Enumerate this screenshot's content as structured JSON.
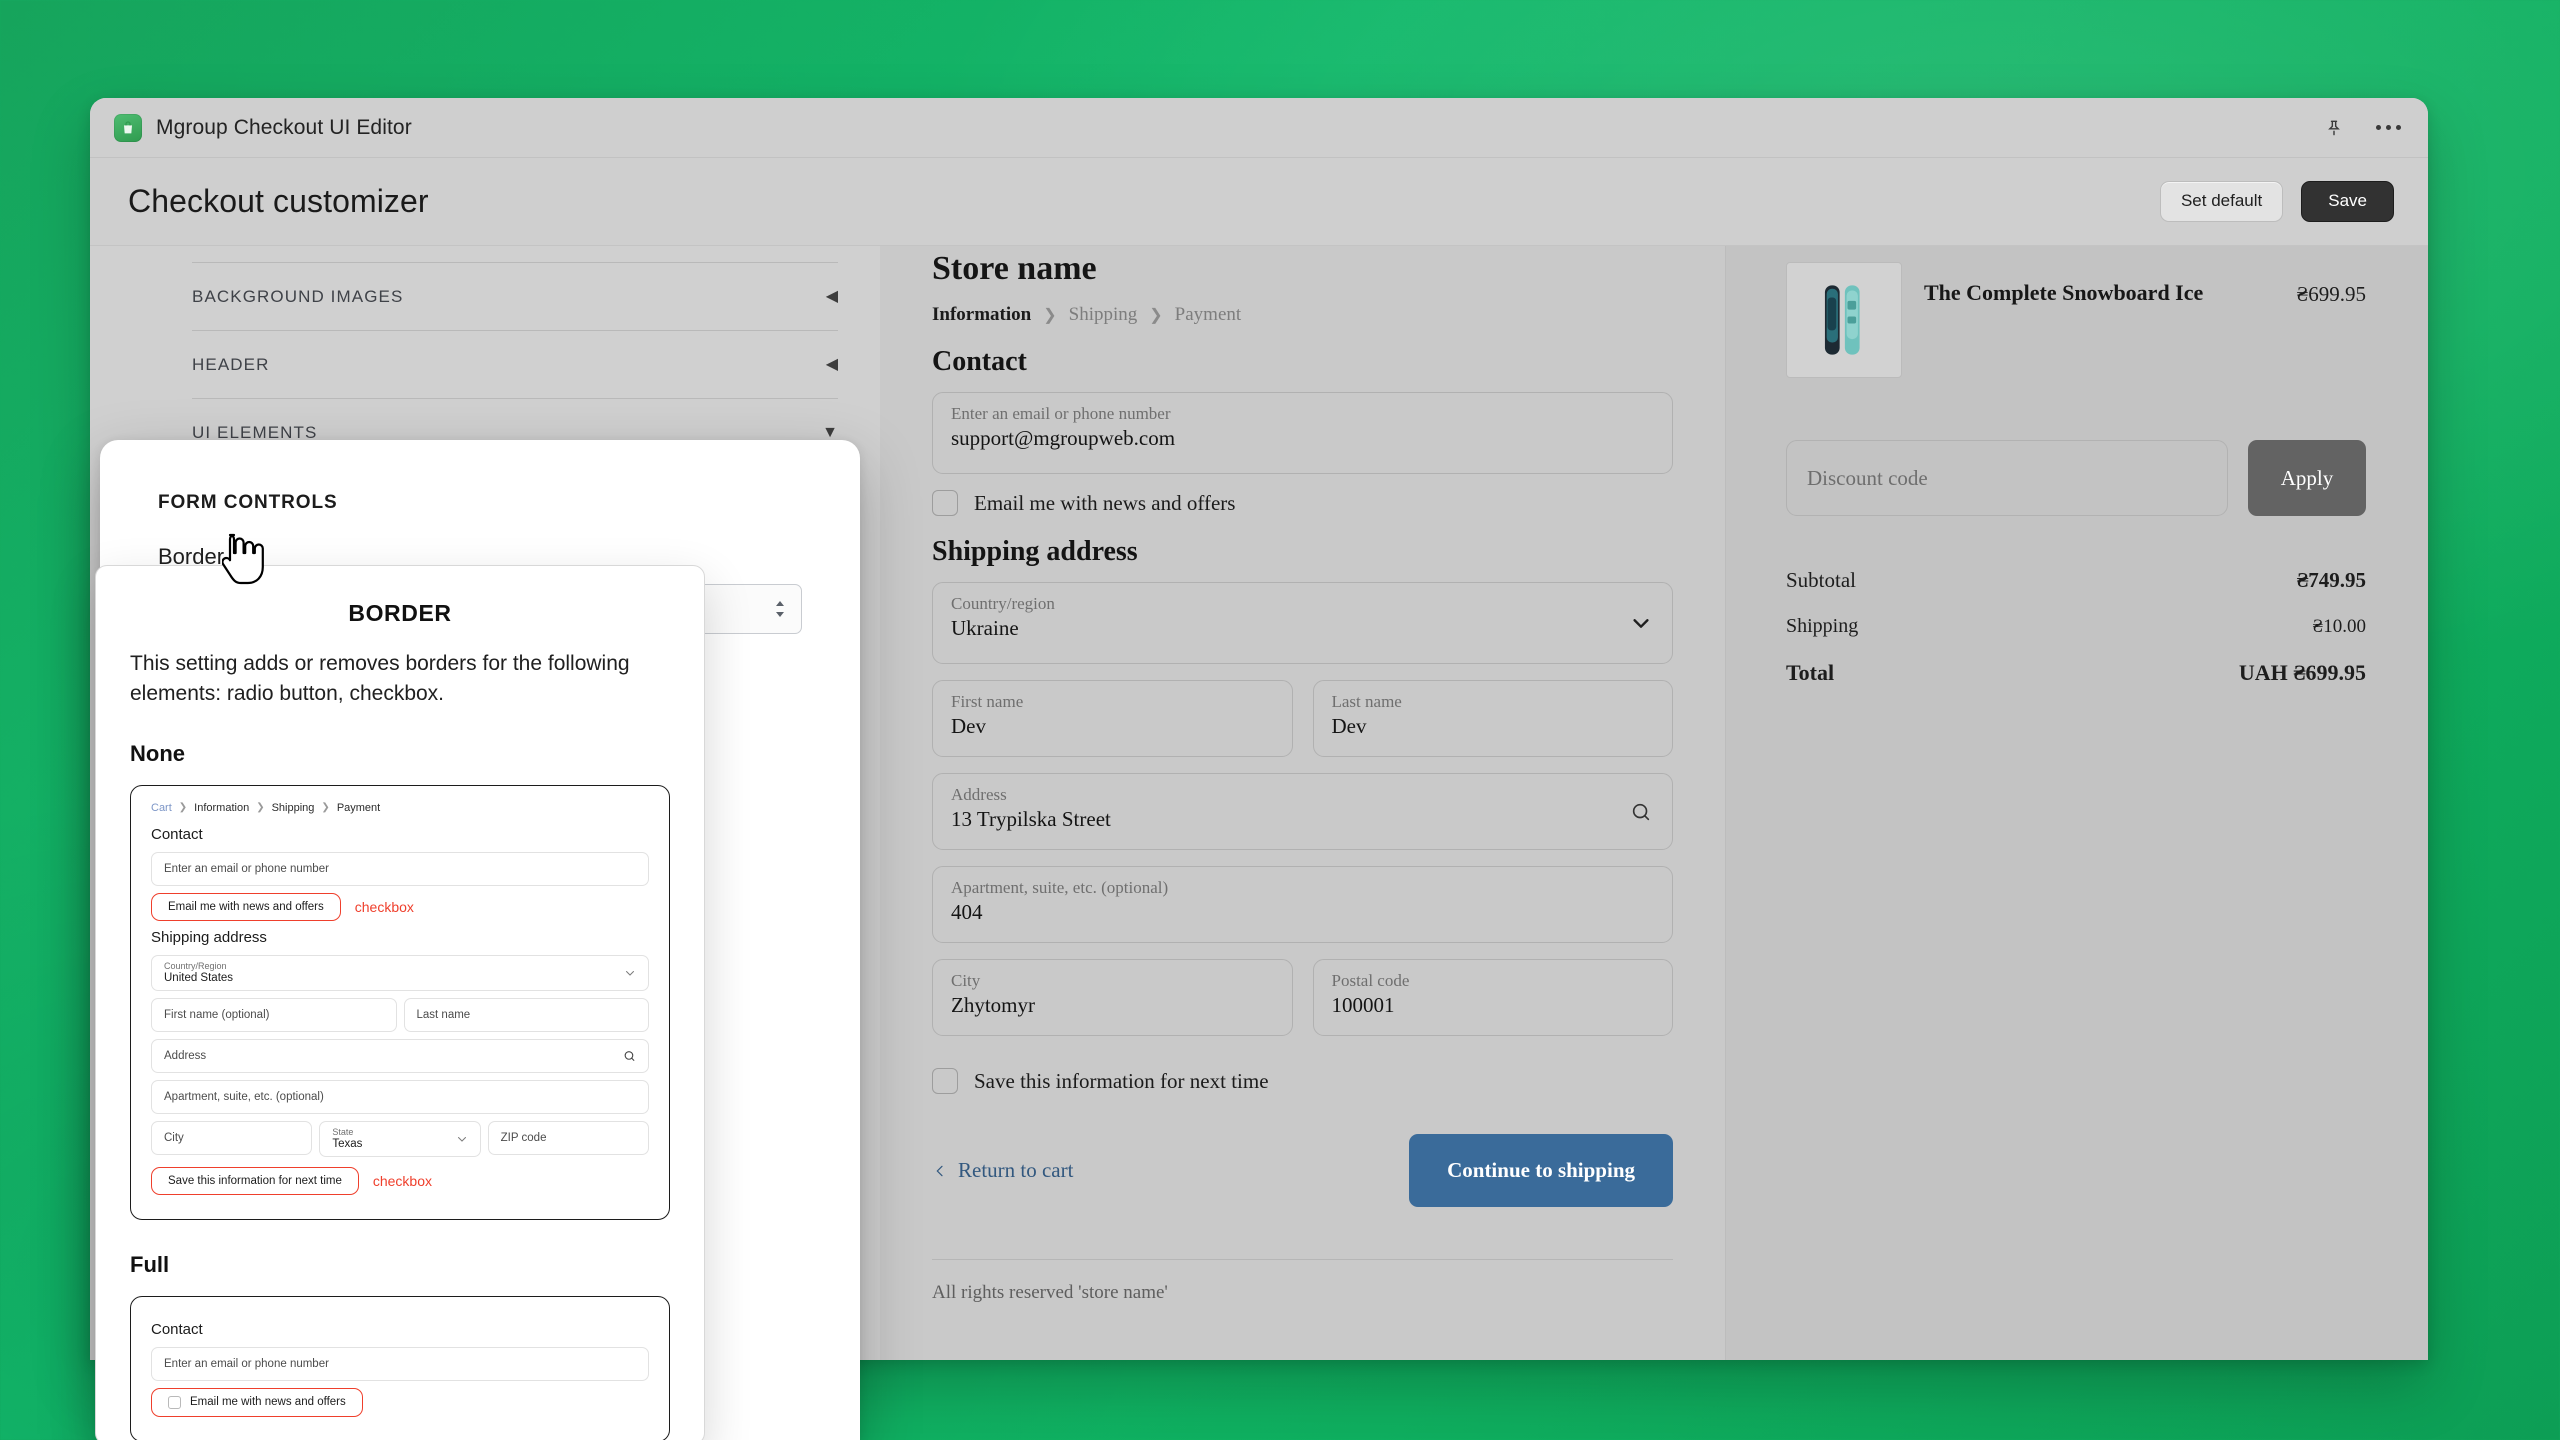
{
  "window": {
    "title": "Mgroup Checkout UI Editor",
    "icons": {
      "pin": "pin-icon",
      "more": "more-icon",
      "app": "app-logo-icon"
    }
  },
  "header": {
    "page_title": "Checkout customizer",
    "set_default_label": "Set default",
    "save_label": "Save"
  },
  "settings": {
    "accordions": [
      {
        "label": "BACKGROUND IMAGES",
        "caret": "◀"
      },
      {
        "label": "HEADER",
        "caret": "◀"
      },
      {
        "label": "UI ELEMENTS",
        "caret": "▼"
      }
    ]
  },
  "popover": {
    "kicker": "FORM CONTROLS",
    "border_label": "Border",
    "help_badge": "?"
  },
  "tooltip": {
    "title": "BORDER",
    "description": "This setting adds or removes borders for the following elements: radio button, checkbox.",
    "none_label": "None",
    "full_label": "Full",
    "checkbox_tag_1": "checkbox",
    "checkbox_tag_2": "checkbox",
    "preview_none": {
      "breadcrumb": [
        "Cart",
        "Information",
        "Shipping",
        "Payment"
      ],
      "contact_heading": "Contact",
      "email_placeholder": "Enter an email or phone number",
      "email_optin": "Email me with news and offers",
      "shipping_heading": "Shipping address",
      "country_label": "Country/Region",
      "country_value": "United States",
      "first_name": "First name (optional)",
      "last_name": "Last name",
      "address": "Address",
      "apartment": "Apartment, suite, etc. (optional)",
      "city": "City",
      "state_label": "State",
      "state_value": "Texas",
      "zip": "ZIP code",
      "save_info": "Save this information for next time"
    },
    "preview_full": {
      "contact_heading": "Contact",
      "email_placeholder": "Enter an email or phone number",
      "email_optin": "Email me with news and offers"
    }
  },
  "checkout": {
    "store_name": "Store name",
    "breadcrumb": [
      {
        "label": "Information",
        "active": true
      },
      {
        "label": "Shipping",
        "active": false
      },
      {
        "label": "Payment",
        "active": false
      }
    ],
    "contact_heading": "Contact",
    "email_label": "Enter an email or phone number",
    "email_value": "support@mgroupweb.com",
    "email_optin": "Email me with news and offers",
    "shipping_heading": "Shipping address",
    "fields": {
      "country_label": "Country/region",
      "country_value": "Ukraine",
      "first_name_label": "First name",
      "first_name_value": "Dev",
      "last_name_label": "Last name",
      "last_name_value": "Dev",
      "address_label": "Address",
      "address_value": "13 Trypilska Street",
      "apartment_label": "Apartment, suite, etc. (optional)",
      "apartment_value": "404",
      "city_label": "City",
      "city_value": "Zhytomyr",
      "postal_label": "Postal code",
      "postal_value": "100001"
    },
    "save_info": "Save this information for next time",
    "return_to_cart": "Return to cart",
    "continue_button": "Continue to shipping",
    "footer_note": "All rights reserved 'store name'"
  },
  "summary": {
    "item_name": "The Complete Snowboard Ice",
    "item_price": "₴699.95",
    "discount_placeholder": "Discount code",
    "apply_label": "Apply",
    "rows": [
      {
        "label": "Subtotal",
        "amount": "₴749.95"
      },
      {
        "label": "Shipping",
        "amount": "₴10.00"
      },
      {
        "label": "Total",
        "amount": "UAH ₴699.95"
      }
    ]
  },
  "colors": {
    "brand_green": "#12b86a",
    "cta_blue": "#3a6b9a",
    "accent_red": "#ef3f2c",
    "badge_teal": "#74b39b"
  }
}
